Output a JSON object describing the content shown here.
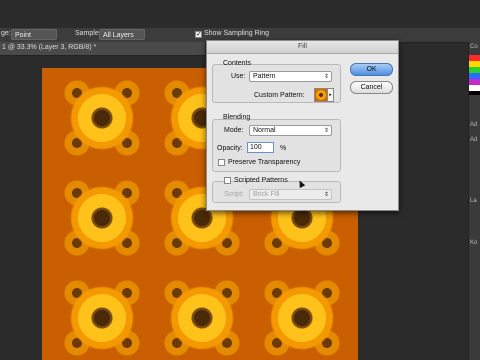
{
  "options_bar": {
    "size_label": "ge:",
    "sample_size_value": "Point Sample",
    "sample_label": "Sample:",
    "sample_value": "All Layers",
    "sampling_ring_label": "Show Sampling Ring",
    "sampling_ring_checked": true
  },
  "document": {
    "tab_title": "1 @ 33.3% (Layer 3, RGB/8) *"
  },
  "fill_dialog": {
    "title": "Fill",
    "contents": {
      "group_title": "Contents",
      "use_label": "Use:",
      "use_value": "Pattern",
      "custom_pattern_label": "Custom Pattern:"
    },
    "blending": {
      "group_title": "Blending",
      "mode_label": "Mode:",
      "mode_value": "Normal",
      "opacity_label": "Opacity:",
      "opacity_value": "100",
      "opacity_unit": "%",
      "preserve_transparency_label": "Preserve Transparency",
      "preserve_transparency_checked": false
    },
    "scripted": {
      "scripted_patterns_label": "Scripted Patterns",
      "scripted_patterns_checked": false,
      "script_label": "Script:",
      "script_value": "Brick Fill"
    },
    "ok_label": "OK",
    "cancel_label": "Cancel"
  },
  "right_panel": {
    "labels": [
      "Co",
      "Ad",
      "Ad",
      "La",
      "Ko"
    ]
  }
}
